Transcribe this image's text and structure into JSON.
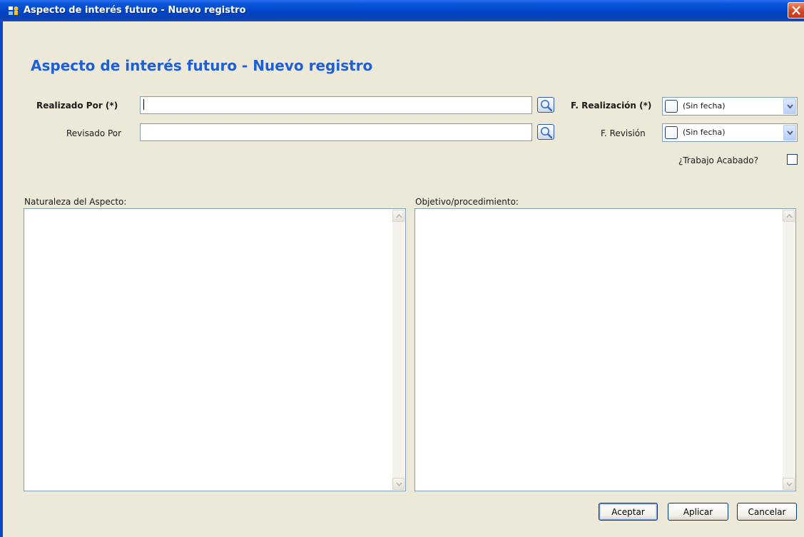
{
  "window": {
    "title": "Aspecto de interés futuro - Nuevo registro",
    "colors": {
      "titlebar": "#0245c6",
      "heading": "#1f5fd3",
      "background": "#ece9d8",
      "close": "#d6492a"
    }
  },
  "form": {
    "heading": "Aspecto de interés futuro - Nuevo registro",
    "realizado_por": {
      "label": "Realizado Por (*)",
      "value": "",
      "search_icon": "magnifier-icon"
    },
    "revisado_por": {
      "label": "Revisado Por",
      "value": "",
      "search_icon": "magnifier-icon"
    },
    "f_realizacion": {
      "label": "F. Realización (*)",
      "value": "(Sin fecha)",
      "checked": false
    },
    "f_revision": {
      "label": "F. Revisión",
      "value": "(Sin fecha)",
      "checked": false
    },
    "trabajo_acabado": {
      "label": "¿Trabajo Acabado?",
      "checked": false
    },
    "naturaleza": {
      "label": "Naturaleza del Aspecto:",
      "value": ""
    },
    "objetivo": {
      "label": "Objetivo/procedimiento:",
      "value": ""
    }
  },
  "buttons": {
    "accept": "Aceptar",
    "apply": "Aplicar",
    "cancel": "Cancelar"
  }
}
